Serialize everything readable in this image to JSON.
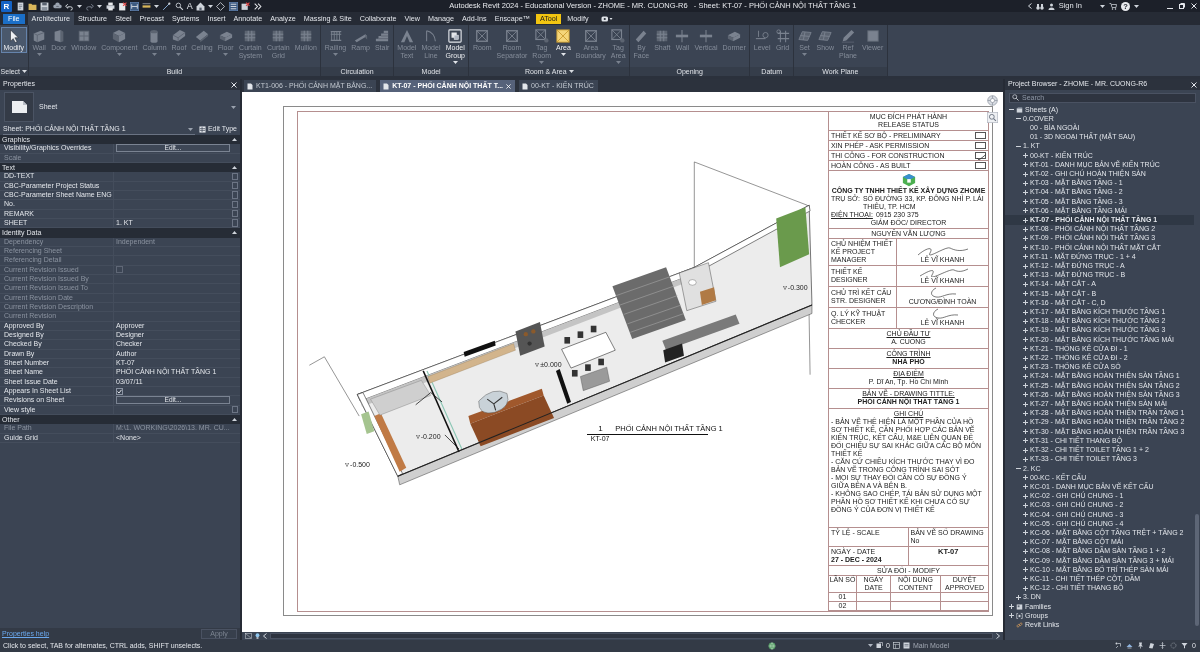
{
  "title_bar": {
    "logo": "R",
    "text_tool": "A",
    "title": "Autodesk Revit 2024 - Educational Version - ZHOME - MR. CUONG-R6   - Sheet: KT-07 - PHỐI CẢNH NỘI THẤT TẦNG 1",
    "sign_in": "Sign In",
    "help": "?"
  },
  "ribbon": {
    "tabs": [
      {
        "label": "File",
        "kind": "application",
        "selected": false
      },
      {
        "label": "Architecture",
        "kind": "tab",
        "selected": true
      },
      {
        "label": "Structure",
        "kind": "tab",
        "selected": false
      },
      {
        "label": "Steel",
        "kind": "tab",
        "selected": false
      },
      {
        "label": "Precast",
        "kind": "tab",
        "selected": false
      },
      {
        "label": "Systems",
        "kind": "tab",
        "selected": false
      },
      {
        "label": "Insert",
        "kind": "tab",
        "selected": false
      },
      {
        "label": "Annotate",
        "kind": "tab",
        "selected": false
      },
      {
        "label": "Analyze",
        "kind": "tab",
        "selected": false
      },
      {
        "label": "Massing & Site",
        "kind": "tab",
        "selected": false
      },
      {
        "label": "Collaborate",
        "kind": "tab",
        "selected": false
      },
      {
        "label": "View",
        "kind": "tab",
        "selected": false
      },
      {
        "label": "Manage",
        "kind": "tab",
        "selected": false
      },
      {
        "label": "Add-Ins",
        "kind": "tab",
        "selected": false
      },
      {
        "label": "Enscape™",
        "kind": "tab",
        "selected": false
      },
      {
        "label": "ATool",
        "kind": "highlighted",
        "selected": false
      },
      {
        "label": "Modify",
        "kind": "tab",
        "selected": false
      }
    ],
    "panels": [
      {
        "label": "Select",
        "menu": true,
        "tools": [
          {
            "label": "Modify",
            "disabled": false,
            "active": true,
            "menu": false
          }
        ]
      },
      {
        "label": "Build",
        "menu": false,
        "tools": [
          {
            "label": "Wall",
            "disabled": true,
            "active": false,
            "menu": true
          },
          {
            "label": "Door",
            "disabled": true,
            "active": false,
            "menu": false
          },
          {
            "label": "Window",
            "disabled": true,
            "active": false,
            "menu": false
          },
          {
            "label": "Component",
            "disabled": true,
            "active": false,
            "menu": true
          },
          {
            "label": "Column",
            "disabled": true,
            "active": false,
            "menu": true
          },
          {
            "label": "Roof",
            "disabled": true,
            "active": false,
            "menu": true
          },
          {
            "label": "Ceiling",
            "disabled": true,
            "active": false,
            "menu": false
          },
          {
            "label": "Floor",
            "disabled": true,
            "active": false,
            "menu": true
          },
          {
            "label": "Curtain System",
            "disabled": true,
            "active": false,
            "menu": false
          },
          {
            "label": "Curtain Grid",
            "disabled": true,
            "active": false,
            "menu": false
          },
          {
            "label": "Mullion",
            "disabled": true,
            "active": false,
            "menu": false
          }
        ]
      },
      {
        "label": "Circulation",
        "menu": false,
        "tools": [
          {
            "label": "Railing",
            "disabled": true,
            "active": false,
            "menu": true
          },
          {
            "label": "Ramp",
            "disabled": true,
            "active": false,
            "menu": false
          },
          {
            "label": "Stair",
            "disabled": true,
            "active": false,
            "menu": false
          }
        ]
      },
      {
        "label": "Model",
        "menu": false,
        "tools": [
          {
            "label": "Model Text",
            "disabled": true,
            "active": false,
            "menu": false
          },
          {
            "label": "Model Line",
            "disabled": true,
            "active": false,
            "menu": false
          },
          {
            "label": "Model Group",
            "disabled": false,
            "active": false,
            "menu": true
          }
        ]
      },
      {
        "label": "Room & Area",
        "menu": true,
        "tools": [
          {
            "label": "Room",
            "disabled": true,
            "active": false,
            "menu": false
          },
          {
            "label": "Room Separator",
            "disabled": true,
            "active": false,
            "menu": false
          },
          {
            "label": "Tag Room",
            "disabled": true,
            "active": false,
            "menu": true
          },
          {
            "label": "Area",
            "disabled": false,
            "active": false,
            "menu": true
          },
          {
            "label": "Area Boundary",
            "disabled": true,
            "active": false,
            "menu": false
          },
          {
            "label": "Tag Area",
            "disabled": true,
            "active": false,
            "menu": true
          }
        ]
      },
      {
        "label": "Opening",
        "menu": false,
        "tools": [
          {
            "label": "By Face",
            "disabled": true,
            "active": false,
            "menu": false
          },
          {
            "label": "Shaft",
            "disabled": true,
            "active": false,
            "menu": false
          },
          {
            "label": "Wall",
            "disabled": true,
            "active": false,
            "menu": false
          },
          {
            "label": "Vertical",
            "disabled": true,
            "active": false,
            "menu": false
          },
          {
            "label": "Dormer",
            "disabled": true,
            "active": false,
            "menu": false
          }
        ]
      },
      {
        "label": "Datum",
        "menu": false,
        "tools": [
          {
            "label": "Level",
            "disabled": true,
            "active": false,
            "menu": false
          },
          {
            "label": "Grid",
            "disabled": true,
            "active": false,
            "menu": false
          }
        ]
      },
      {
        "label": "Work Plane",
        "menu": false,
        "tools": [
          {
            "label": "Set",
            "disabled": true,
            "active": false,
            "menu": true
          },
          {
            "label": "Show",
            "disabled": true,
            "active": false,
            "menu": false
          },
          {
            "label": "Ref Plane",
            "disabled": true,
            "active": false,
            "menu": false
          },
          {
            "label": "Viewer",
            "disabled": true,
            "active": false,
            "menu": false
          }
        ]
      }
    ]
  },
  "properties": {
    "title": "Properties",
    "type_name": "Sheet",
    "instance": "Sheet: PHỐI CẢNH NỘI THẤT TẦNG 1",
    "edit_type": "Edit Type",
    "groups": [
      {
        "name": "Graphics",
        "expanded": true,
        "rows": [
          {
            "name": "Visibility/Graphics Overrides",
            "kind": "button",
            "value": "Edit...",
            "disabled": false
          },
          {
            "name": "Scale",
            "kind": "text",
            "disabled": true
          }
        ]
      },
      {
        "name": "Text",
        "expanded": true,
        "rows": [
          {
            "name": "DD-TEXT",
            "kind": "parameter",
            "disabled": false
          },
          {
            "name": "CBC-Parameter Project Status",
            "kind": "parameter",
            "disabled": false
          },
          {
            "name": "CBC-Parameter Sheet Name ENG",
            "kind": "parameter",
            "disabled": false
          },
          {
            "name": "No.",
            "kind": "parameter",
            "disabled": false
          },
          {
            "name": "REMARK",
            "kind": "parameter",
            "disabled": false
          },
          {
            "name": "SHEET",
            "kind": "parameter",
            "value": "1. KT",
            "disabled": false
          }
        ]
      },
      {
        "name": "Identity Data",
        "expanded": true,
        "rows": [
          {
            "name": "Dependency",
            "kind": "text",
            "value": "Independent",
            "disabled": true
          },
          {
            "name": "Referencing Sheet",
            "kind": "text",
            "disabled": true
          },
          {
            "name": "Referencing Detail",
            "kind": "text",
            "disabled": true
          },
          {
            "name": "Current Revision Issued",
            "kind": "checkbox",
            "checked": false,
            "disabled": true
          },
          {
            "name": "Current Revision Issued By",
            "kind": "text",
            "disabled": true
          },
          {
            "name": "Current Revision Issued To",
            "kind": "text",
            "disabled": true
          },
          {
            "name": "Current Revision Date",
            "kind": "text",
            "disabled": true
          },
          {
            "name": "Current Revision Description",
            "kind": "text",
            "disabled": true
          },
          {
            "name": "Current Revision",
            "kind": "text",
            "disabled": true
          },
          {
            "name": "Approved By",
            "kind": "text",
            "value": "Approver",
            "disabled": false
          },
          {
            "name": "Designed By",
            "kind": "text",
            "value": "Designer",
            "disabled": false
          },
          {
            "name": "Checked By",
            "kind": "text",
            "value": "Checker",
            "disabled": false
          },
          {
            "name": "Drawn By",
            "kind": "text",
            "value": "Author",
            "disabled": false
          },
          {
            "name": "Sheet Number",
            "kind": "text",
            "value": "KT-07",
            "disabled": false
          },
          {
            "name": "Sheet Name",
            "kind": "text",
            "value": "PHỐI CẢNH NỘI THẤT TẦNG 1",
            "disabled": false
          },
          {
            "name": "Sheet Issue Date",
            "kind": "text",
            "value": "03/07/11",
            "disabled": false
          },
          {
            "name": "Appears In Sheet List",
            "kind": "checkbox",
            "checked": true,
            "disabled": false
          },
          {
            "name": "Revisions on Sheet",
            "kind": "button",
            "value": "Edit...",
            "disabled": false
          },
          {
            "name": "View style",
            "kind": "parameter",
            "disabled": false
          }
        ]
      },
      {
        "name": "Other",
        "expanded": true,
        "rows": [
          {
            "name": "File Path",
            "kind": "text",
            "value": "M:\\1. WORKING\\2026\\13. MR. CU...",
            "disabled": true
          },
          {
            "name": "Guide Grid",
            "kind": "text",
            "value": "<None>",
            "disabled": false
          }
        ]
      }
    ],
    "help_link": "Properties help",
    "apply": {
      "label": "Apply",
      "disabled": true
    }
  },
  "view_tabs": [
    {
      "label": "KT1-006 - PHỐI CẢNH MẶT BẰNG...",
      "selected": false
    },
    {
      "label": "KT-07 - PHỐI CẢNH NỘI THẤT T...",
      "selected": true
    },
    {
      "label": "00-KT - KIẾN TRÚC",
      "selected": false
    }
  ],
  "sheet": {
    "level_tags": [
      "-0.300",
      "±0.000",
      "-0.200",
      "-0.500"
    ],
    "view_title": {
      "number": "1",
      "title": "PHỐI CẢNH NỘI THẤT TẦNG 1",
      "sheet": "KT-07"
    },
    "title_block": {
      "release_title": "MỤC ĐÍCH PHÁT HÀNH",
      "release_subtitle": "RELEASE STATUS",
      "release_status": [
        {
          "label": "THIẾT KẾ SƠ BỘ - PRELIMINARY",
          "checked": false
        },
        {
          "label": "XIN PHÉP - ASK PERMISSION",
          "checked": false
        },
        {
          "label": "THI CÔNG - FOR CONSTRUCTION",
          "checked": true
        },
        {
          "label": "HOÀN CÔNG - AS BUILT",
          "checked": false
        }
      ],
      "company_name": "CÔNG TY TNHH THIẾT KẾ XÂY DỰNG ZHOME",
      "address_label": "TRỤ SỞ:",
      "address": "SỐ ĐƯỜNG 33, KP. ĐÔNG NHÌ P. LÁI THIÊU, TP. HCM",
      "phone_label": "ĐIỆN THOẠI:",
      "phone": "0915 230 375",
      "director_title": "GIÁM ĐỐC/ DIRECTOR",
      "director_name": "NGUYỄN VĂN LƯỢNG",
      "signatures": [
        {
          "role": "CHỦ NHIỆM THIẾT KẾ PROJECT MANAGER",
          "name": "LÊ VĨ KHANH"
        },
        {
          "role": "THIẾT KẾ DESIGNER",
          "name": "LÊ VĨ KHANH"
        },
        {
          "role": "CHỦ TRÌ KẾT CẤU STR. DESIGNER",
          "name": "CƯƠNG/ĐÌNH TOÀN"
        },
        {
          "role": "Q. LÝ KỸ THUẬT CHECKER",
          "name": "LÊ VĨ KHANH"
        }
      ],
      "fields": [
        {
          "heading": "CHỦ ĐẦU TƯ",
          "value": "A. CUONG",
          "bold": false
        },
        {
          "heading": "CÔNG TRÌNH",
          "value": "NHÀ PHỐ",
          "bold": true
        },
        {
          "heading": "ĐỊA ĐIỂM",
          "value": "P. Dĩ An, Tp. Hồ Chí Minh",
          "bold": false
        },
        {
          "heading": "BẢN VẼ - DRAWING TITTLE:",
          "value": "PHỐI CẢNH NỘI THẤT TẦNG 1",
          "bold": true
        }
      ],
      "notes_heading": "GHI CHÚ",
      "notes": [
        "- BẢN VẼ THỂ HIỆN LÀ MỘT PHẦN CỦA HỒ SƠ THIẾT KẾ, CẦN PHỐI HỢP CÁC BẢN VẼ KIẾN TRÚC, KẾT CẤU, M&E LIÊN QUAN ĐỂ ĐỐI CHIẾU SỰ SAI KHÁC GIỮA CÁC BỘ MÔN THIẾT KẾ",
        "- CĂN CỨ CHIỀU KÍCH THƯỚC THAY VÌ ĐO BẢN VẼ TRONG CÔNG TRÌNH SAI SÓT",
        "- MỌI SỰ THAY ĐỔI CẦN CÓ SỰ ĐỒNG Ý GIỮA BÊN A VÀ BÊN B.",
        "- KHÔNG SAO CHÉP, TÁI BẢN SỬ DỤNG MỘT PHẦN HỒ SƠ THIẾT KẾ KHI CHƯA CÓ SỰ ĐỒNG Ý CỦA ĐƠN VỊ THIẾT KẾ"
      ],
      "scale_label": "TỶ LỆ - SCALE",
      "drawing_no_label": "BẢN VẼ SỐ DRAWING No",
      "date_label": "NGÀY - DATE",
      "date": "27 - DEC - 2024",
      "drawing_no": "KT-07",
      "revision_heading": "SỬA ĐỔI - MODIFY",
      "revision_columns": [
        "LẦN SỐ",
        "NGÀY DATE",
        "NỘI DUNG CONTENT",
        "DUYỆT APPROVED"
      ],
      "revision_rows": [
        "01",
        "02"
      ]
    }
  },
  "project_browser": {
    "title": "Project Browser - ZHOME - MR. CUONG-R6",
    "search": {
      "placeholder": "Search"
    },
    "tree": [
      {
        "label": "Sheets (A)",
        "kind": "sheets",
        "expanded": true,
        "selected": false,
        "children": [
          {
            "label": "0.COVER",
            "expanded": true,
            "selected": false,
            "children": [
              {
                "label": "00 - BÌA NGOÀI",
                "selected": false
              },
              {
                "label": "01 - 3D NGOẠI THẤT (MẶT SAU)",
                "selected": false
              }
            ]
          },
          {
            "label": "1. KT",
            "expanded": true,
            "selected": false,
            "children": [
              {
                "label": "00-KT - KIẾN TRÚC",
                "expanded": false,
                "selected": false
              },
              {
                "label": "KT-01 - DANH MỤC BẢN VẼ KIẾN TRÚC",
                "expanded": false,
                "selected": false
              },
              {
                "label": "KT-02 - GHI CHÚ HOÀN THIỆN SÀN",
                "expanded": false,
                "selected": false
              },
              {
                "label": "KT-03 - MẶT BẰNG TẦNG - 1",
                "expanded": false,
                "selected": false
              },
              {
                "label": "KT-04 - MẶT BẰNG TẦNG - 2",
                "expanded": false,
                "selected": false
              },
              {
                "label": "KT-05 - MẶT BẰNG TẦNG - 3",
                "expanded": false,
                "selected": false
              },
              {
                "label": "KT-06 - MẶT BẰNG TẦNG MÁI",
                "expanded": false,
                "selected": false
              },
              {
                "label": "KT-07 - PHỐI CẢNH NỘI THẤT TẦNG 1",
                "expanded": false,
                "selected": true
              },
              {
                "label": "KT-08 - PHỐI CẢNH NỘI THẤT TẦNG 2",
                "expanded": false,
                "selected": false
              },
              {
                "label": "KT-09 - PHỐI CẢNH NỘI THẤT TẦNG 3",
                "expanded": false,
                "selected": false
              },
              {
                "label": "KT-10 - PHỐI CẢNH NỘI THẤT MẶT CẮT",
                "expanded": false,
                "selected": false
              },
              {
                "label": "KT-11 - MẶT ĐỨNG TRỤC - 1 + 4",
                "expanded": false,
                "selected": false
              },
              {
                "label": "KT-12 - MẶT ĐỨNG TRỤC - A",
                "expanded": false,
                "selected": false
              },
              {
                "label": "KT-13 - MẶT ĐỨNG TRỤC - B",
                "expanded": false,
                "selected": false
              },
              {
                "label": "KT-14 - MẶT CẮT - A",
                "expanded": false,
                "selected": false
              },
              {
                "label": "KT-15 - MẶT CẮT - B",
                "expanded": false,
                "selected": false
              },
              {
                "label": "KT-16 - MẶT CẮT - C, D",
                "expanded": false,
                "selected": false
              },
              {
                "label": "KT-17 - MẶT BẰNG KÍCH THƯỚC TẦNG 1",
                "expanded": false,
                "selected": false
              },
              {
                "label": "KT-18 - MẶT BẰNG KÍCH THƯỚC TẦNG 2",
                "expanded": false,
                "selected": false
              },
              {
                "label": "KT-19 - MẶT BẰNG KÍCH THƯỚC TẦNG 3",
                "expanded": false,
                "selected": false
              },
              {
                "label": "KT-20 - MẶT BẰNG KÍCH THƯỚC TẦNG MÁI",
                "expanded": false,
                "selected": false
              },
              {
                "label": "KT-21 - THỐNG KÊ CỬA ĐI - 1",
                "expanded": false,
                "selected": false
              },
              {
                "label": "KT-22 - THỐNG KÊ CỬA ĐI - 2",
                "expanded": false,
                "selected": false
              },
              {
                "label": "KT-23 - THỐNG KÊ CỬA SỔ",
                "expanded": false,
                "selected": false
              },
              {
                "label": "KT-24 - MẶT BẰNG HOÀN THIỆN SÀN TẦNG 1",
                "expanded": false,
                "selected": false
              },
              {
                "label": "KT-25 - MẶT BẰNG HOÀN THIỆN SÀN TẦNG 2",
                "expanded": false,
                "selected": false
              },
              {
                "label": "KT-26 - MẶT BẰNG HOÀN THIỆN SÀN TẦNG 3",
                "expanded": false,
                "selected": false
              },
              {
                "label": "KT-27 - MẶT BẰNG HOÀN THIỆN SÀN MÁI",
                "expanded": false,
                "selected": false
              },
              {
                "label": "KT-28 - MẶT BẰNG HOÀN THIỆN TRẦN TẦNG 1",
                "expanded": false,
                "selected": false
              },
              {
                "label": "KT-29 - MẶT BẰNG HOÀN THIỆN TRẦN TẦNG 2",
                "expanded": false,
                "selected": false
              },
              {
                "label": "KT-30 - MẶT BẰNG HOÀN THIỆN TRẦN TẦNG 3",
                "expanded": false,
                "selected": false
              },
              {
                "label": "KT-31 - CHI TIẾT THANG BỘ",
                "expanded": false,
                "selected": false
              },
              {
                "label": "KT-32 - CHI TIẾT TOILET TẦNG 1 + 2",
                "expanded": false,
                "selected": false
              },
              {
                "label": "KT-33 - CHI TIẾT TOILET TẦNG 3",
                "expanded": false,
                "selected": false
              }
            ]
          },
          {
            "label": "2. KC",
            "expanded": true,
            "selected": false,
            "children": [
              {
                "label": "00-KC - KẾT CẤU",
                "expanded": false,
                "selected": false
              },
              {
                "label": "KC-01 - DANH MỤC BẢN VẼ KẾT CẤU",
                "expanded": false,
                "selected": false
              },
              {
                "label": "KC-02 - GHI CHÚ CHUNG - 1",
                "expanded": false,
                "selected": false
              },
              {
                "label": "KC-03 - GHI CHÚ CHUNG - 2",
                "expanded": false,
                "selected": false
              },
              {
                "label": "KC-04 - GHI CHÚ CHUNG - 3",
                "expanded": false,
                "selected": false
              },
              {
                "label": "KC-05 - GHI CHÚ CHUNG - 4",
                "expanded": false,
                "selected": false
              },
              {
                "label": "KC-06 - MẶT BẰNG CỘT TẦNG TRỆT + TẦNG 2",
                "expanded": false,
                "selected": false
              },
              {
                "label": "KC-07 - MẶT BẰNG CỘT MÁI",
                "expanded": false,
                "selected": false
              },
              {
                "label": "KC-08 - MẶT BẰNG DẦM SÀN TẦNG 1 + 2",
                "expanded": false,
                "selected": false
              },
              {
                "label": "KC-09 - MẶT BẰNG DẦM SÀN TẦNG 3 + MÁI",
                "expanded": false,
                "selected": false
              },
              {
                "label": "KC-10 - MẶT BẰNG BỐ TRÍ THÉP SÀN MÁI",
                "expanded": false,
                "selected": false
              },
              {
                "label": "KC-11 - CHI TIẾT THÉP CỘT, DẦM",
                "expanded": false,
                "selected": false
              },
              {
                "label": "KC-12 - CHI TIẾT THANG BỘ",
                "expanded": false,
                "selected": false
              }
            ]
          },
          {
            "label": "3. DN",
            "expanded": false,
            "selected": false
          }
        ]
      },
      {
        "label": "Families",
        "kind": "families",
        "expanded": false,
        "selected": false
      },
      {
        "label": "Groups",
        "kind": "groups",
        "expanded": false,
        "selected": false
      },
      {
        "label": "Revit Links",
        "kind": "links",
        "selected": false
      }
    ]
  },
  "status_bar": {
    "message": "Click to select, TAB for alternates, CTRL adds, SHIFT unselects.",
    "editing_requests": "0",
    "model": "Main Model",
    "selection_count": "0"
  }
}
